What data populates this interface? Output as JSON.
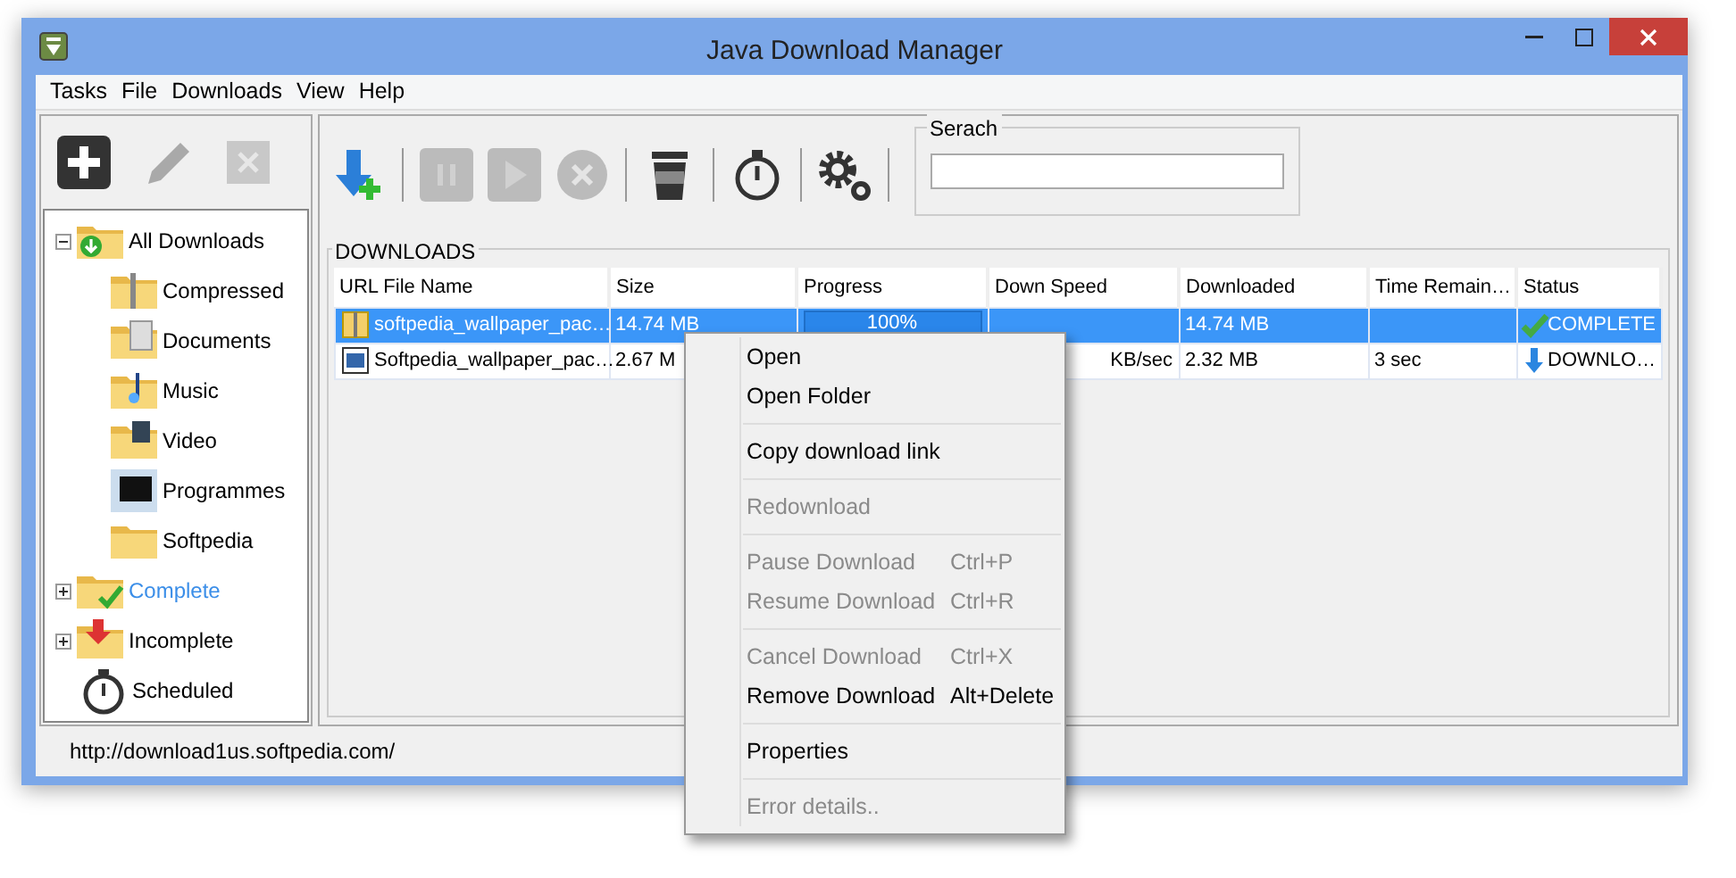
{
  "window": {
    "title": "Java Download Manager"
  },
  "menu_bar": [
    "Tasks",
    "File",
    "Downloads",
    "View",
    "Help"
  ],
  "side_toolbar": [
    {
      "kind": "add",
      "disabled": false
    },
    {
      "kind": "edit",
      "disabled": true
    },
    {
      "kind": "delete",
      "disabled": true
    }
  ],
  "tree": [
    {
      "label": "All Downloads",
      "kind": "all",
      "expanded": true,
      "selected": false,
      "children": [
        {
          "label": "Compressed",
          "kind": "zip",
          "selected": false
        },
        {
          "label": "Documents",
          "kind": "docs",
          "selected": false
        },
        {
          "label": "Music",
          "kind": "music",
          "selected": false
        },
        {
          "label": "Video",
          "kind": "video",
          "selected": false
        },
        {
          "label": "Programmes",
          "kind": "prog",
          "selected": false
        },
        {
          "label": "Softpedia",
          "kind": "folder",
          "selected": false
        }
      ]
    },
    {
      "label": "Complete",
      "kind": "complete",
      "expanded": false,
      "selected": true
    },
    {
      "label": "Incomplete",
      "kind": "incomplete",
      "expanded": false,
      "selected": false
    },
    {
      "label": "Scheduled",
      "kind": "timer",
      "selected": false
    }
  ],
  "toolbar": [
    {
      "kind": "add-download",
      "disabled": false
    },
    {
      "kind": "separator"
    },
    {
      "kind": "pause",
      "disabled": true
    },
    {
      "kind": "play",
      "disabled": true
    },
    {
      "kind": "cancel",
      "disabled": true
    },
    {
      "kind": "separator"
    },
    {
      "kind": "trash",
      "disabled": false
    },
    {
      "kind": "separator"
    },
    {
      "kind": "timer",
      "disabled": false
    },
    {
      "kind": "separator"
    },
    {
      "kind": "settings",
      "disabled": false
    },
    {
      "kind": "separator"
    }
  ],
  "search": {
    "label": "Serach"
  },
  "downloads": {
    "title": "DOWNLOADS",
    "columns": [
      "URL File Name",
      "Size",
      "Progress",
      "Down Speed",
      "Downloaded",
      "Time Remain…",
      "Status"
    ],
    "rows": [
      {
        "selected": true,
        "file": {
          "kind": "archive",
          "text": "softpedia_wallpaper_pac…"
        },
        "size": "14.74 MB",
        "progress": "100%",
        "level": 1,
        "speed": "",
        "downloaded": "14.74 MB",
        "time": "",
        "status": {
          "kind": "complete",
          "text": "COMPLETE"
        }
      },
      {
        "selected": false,
        "file": {
          "kind": "document",
          "text": "Softpedia_wallpaper_pac…"
        },
        "size": "2.67 M",
        "progress": "",
        "speed": "KB/sec",
        "downloaded": "2.32 MB",
        "time": "3 sec",
        "status": {
          "kind": "downloading",
          "text": "DOWNLO…"
        }
      }
    ]
  },
  "status_bar": "http://download1us.softpedia.com/",
  "context_menu": [
    {
      "kind": "item",
      "label": "Open",
      "disabled": false
    },
    {
      "kind": "item",
      "label": "Open Folder",
      "disabled": false
    },
    {
      "kind": "separator"
    },
    {
      "kind": "item",
      "label": "Copy download link",
      "disabled": false
    },
    {
      "kind": "separator"
    },
    {
      "kind": "item",
      "label": "Redownload",
      "disabled": true
    },
    {
      "kind": "separator"
    },
    {
      "kind": "item",
      "label": "Pause Download",
      "shortcut": "Ctrl+P",
      "disabled": true
    },
    {
      "kind": "item",
      "label": "Resume Download",
      "shortcut": "Ctrl+R",
      "disabled": true
    },
    {
      "kind": "separator"
    },
    {
      "kind": "item",
      "label": "Cancel Download",
      "shortcut": "Ctrl+X",
      "disabled": true
    },
    {
      "kind": "item",
      "label": "Remove Download",
      "shortcut": "Alt+Delete",
      "disabled": false
    },
    {
      "kind": "separator"
    },
    {
      "kind": "item",
      "label": "Properties",
      "disabled": false
    },
    {
      "kind": "separator"
    },
    {
      "kind": "item",
      "label": "Error details..",
      "disabled": true
    }
  ]
}
